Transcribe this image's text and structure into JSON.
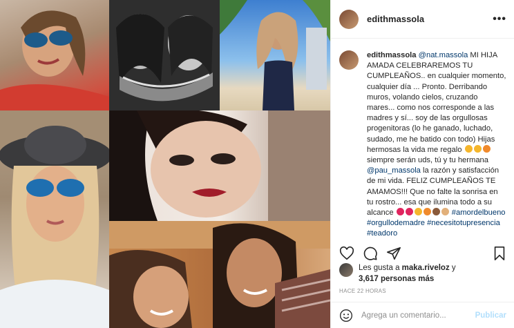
{
  "post": {
    "username": "edithmassola",
    "more_label": "•••"
  },
  "caption": {
    "username": "edithmassola",
    "mention1": "@nat.massola",
    "text1": " MI HIJA AMADA CELEBRAREMOS TU CUMPLEAÑOS.. en cualquier momento, cualquier día ... Pronto. Derribando muros, volando cielos, cruzando mares... como nos corresponde a las madres y sí... soy de las orgullosas progenitoras (lo he ganado, luchado, sudado, me he batido con todo) Hijas hermosas la vida me regalo ",
    "text2": " siempre serán uds, tú y tu hermana ",
    "mention2": "@pau_massola",
    "text3": " la razón y satisfacción de mi vida. FELIZ CUMPLEAÑOS TE AMAMOS!!! Que no falte la sonrisa en tu rostro... esa que ilumina todo a su alcance ",
    "hashtags": [
      "#amordelbueno",
      "#orgullodemadre",
      "#necesitotupresencia",
      "#teadoro"
    ]
  },
  "likes": {
    "prefix": "Les gusta a ",
    "user": "maka.riveloz",
    "suffix": " y",
    "count_text": "3,617 personas más"
  },
  "time_ago": "HACE 22 HORAS",
  "comment_box": {
    "placeholder": "Agrega un comentario...",
    "publish_label": "Publicar"
  },
  "icons": [
    "heart-icon",
    "comment-icon",
    "share-icon",
    "bookmark-icon",
    "emoji-icon",
    "more-icon"
  ],
  "colors": {
    "link": "#00376b",
    "publish": "#b2dffc",
    "muted": "#8e8e8e"
  }
}
